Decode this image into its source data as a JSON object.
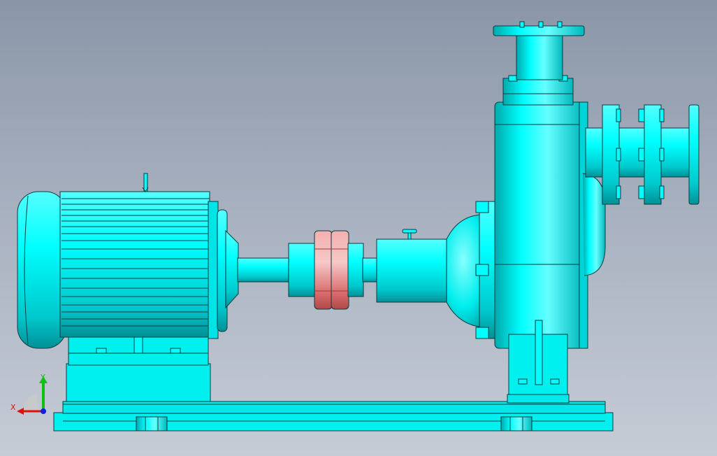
{
  "viewport": {
    "background_top": "#8a96a8",
    "background_bottom": "#c6ccd6"
  },
  "model": {
    "body_color": "#00f0f0",
    "body_shadow": "#00a8ac",
    "edge_color": "#0a3a3e",
    "coupling_color": "#e88a8a"
  },
  "triad": {
    "x_label": "X",
    "y_label": "Y",
    "x_color": "#e01010",
    "y_color": "#10c010",
    "z_color": "#1020e0"
  }
}
